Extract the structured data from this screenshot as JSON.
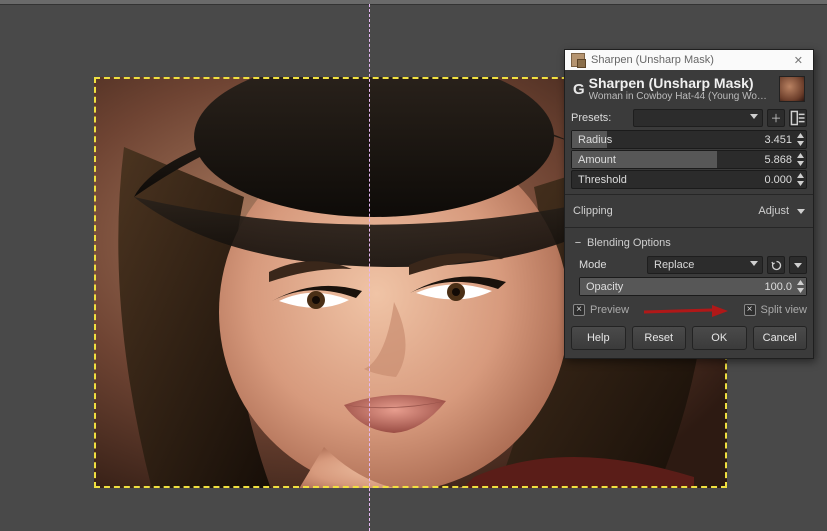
{
  "titlebar": {
    "text": "Sharpen (Unsharp Mask)"
  },
  "header": {
    "title": "Sharpen (Unsharp Mask)",
    "subtitle": "Woman in Cowboy Hat-44 (Young Woman in …"
  },
  "presets": {
    "label": "Presets:",
    "value": ""
  },
  "sliders": {
    "radius": {
      "label": "Radius",
      "value": "3.451",
      "fill_pct": 15
    },
    "amount": {
      "label": "Amount",
      "value": "5.868",
      "fill_pct": 62
    },
    "threshold": {
      "label": "Threshold",
      "value": "0.000",
      "fill_pct": 0
    }
  },
  "clipping": {
    "label": "Clipping",
    "value": "Adjust"
  },
  "blending": {
    "heading": "Blending Options",
    "mode": {
      "label": "Mode",
      "value": "Replace"
    },
    "opacity": {
      "label": "Opacity",
      "value": "100.0",
      "fill_pct": 100
    }
  },
  "checks": {
    "preview": "Preview",
    "split_view": "Split view"
  },
  "buttons": {
    "help": "Help",
    "reset": "Reset",
    "ok": "OK",
    "cancel": "Cancel"
  },
  "icons": {
    "collapse": "−",
    "add": "＋"
  }
}
